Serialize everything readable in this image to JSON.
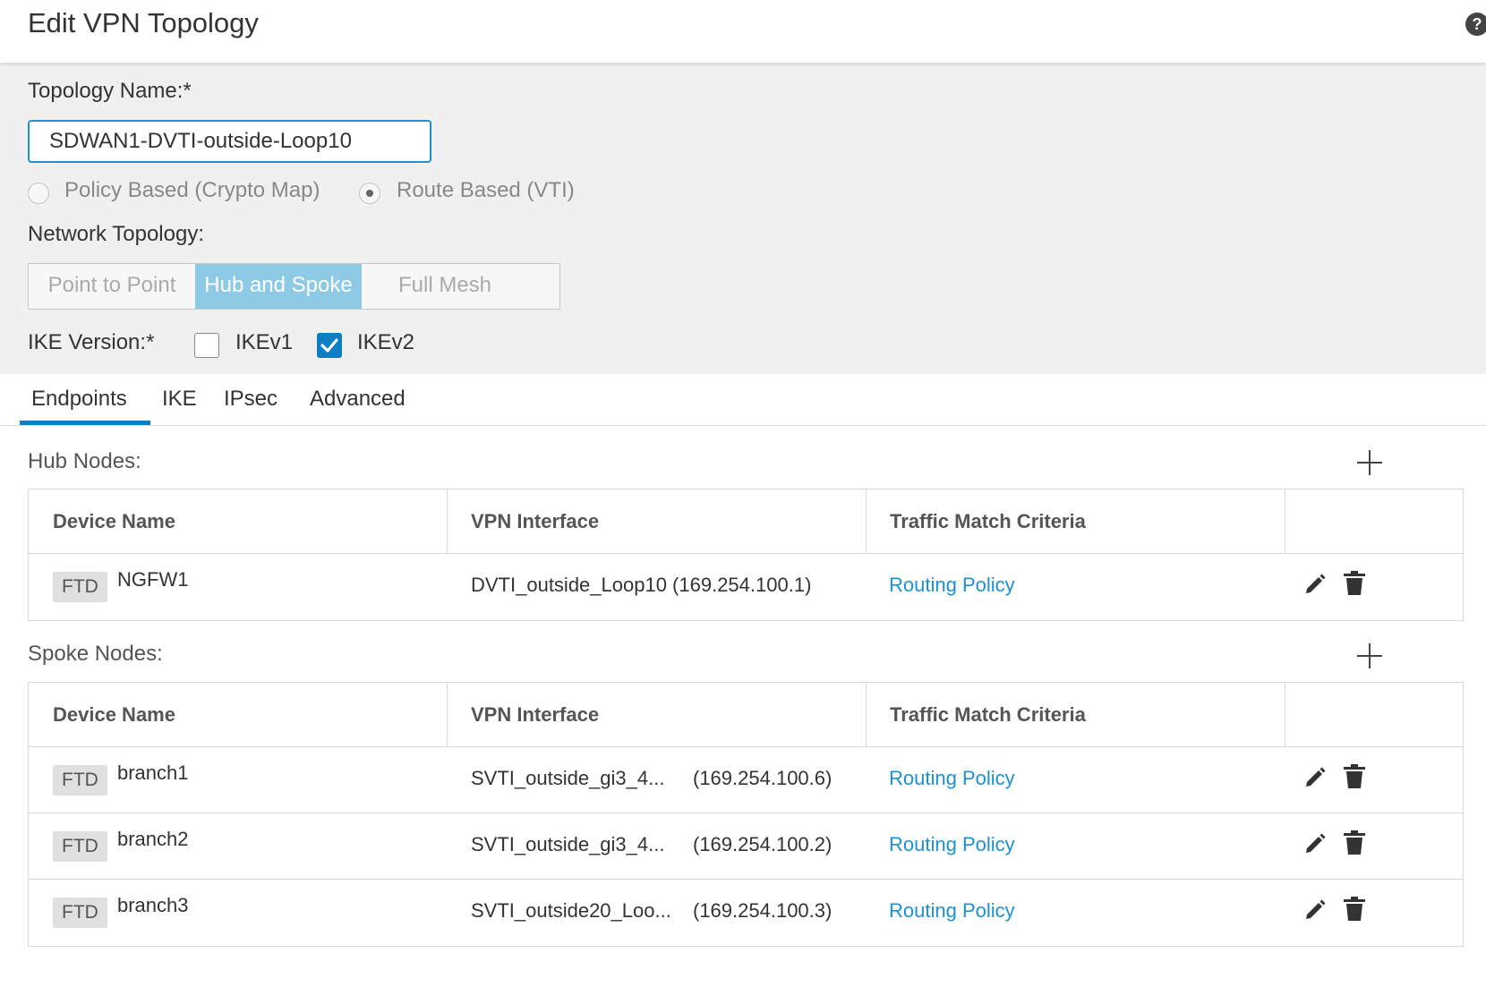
{
  "header": {
    "title": "Edit VPN Topology",
    "help_icon": "help-icon"
  },
  "form": {
    "topology_name_label": "Topology Name:*",
    "topology_name_value": "SDWAN1-DVTI-outside-Loop10",
    "vpn_type_options": [
      {
        "label": "Policy Based (Crypto Map)",
        "selected": false
      },
      {
        "label": "Route Based (VTI)",
        "selected": true
      }
    ],
    "network_topology_label": "Network Topology:",
    "network_topology_options": [
      {
        "label": "Point to Point",
        "active": false
      },
      {
        "label": "Hub and Spoke",
        "active": true
      },
      {
        "label": "Full Mesh",
        "active": false
      }
    ],
    "ike_version_label": "IKE Version:*",
    "ike_options": [
      {
        "label": "IKEv1",
        "checked": false
      },
      {
        "label": "IKEv2",
        "checked": true
      }
    ]
  },
  "tabs": [
    {
      "label": "Endpoints",
      "active": true
    },
    {
      "label": "IKE",
      "active": false
    },
    {
      "label": "IPsec",
      "active": false
    },
    {
      "label": "Advanced",
      "active": false
    }
  ],
  "columns": [
    "Device Name",
    "VPN Interface",
    "Traffic Match Criteria"
  ],
  "hub": {
    "title": "Hub Nodes:",
    "rows": [
      {
        "badge": "FTD",
        "name": "NGFW1",
        "interface": "DVTI_outside_Loop10 (169.254.100.1)",
        "ip": "",
        "criteria": "Routing Policy"
      }
    ]
  },
  "spoke": {
    "title": "Spoke Nodes:",
    "rows": [
      {
        "badge": "FTD",
        "name": "branch1",
        "interface": "SVTI_outside_gi3_4...",
        "ip": "(169.254.100.6)",
        "criteria": "Routing Policy"
      },
      {
        "badge": "FTD",
        "name": "branch2",
        "interface": "SVTI_outside_gi3_4...",
        "ip": "(169.254.100.2)",
        "criteria": "Routing Policy"
      },
      {
        "badge": "FTD",
        "name": "branch3",
        "interface": "SVTI_outside20_Loo...",
        "ip": "(169.254.100.3)",
        "criteria": "Routing Policy"
      }
    ]
  },
  "colors": {
    "accent": "#0b7ec4",
    "link": "#1b91d6",
    "segment_active": "#8ecae6"
  }
}
